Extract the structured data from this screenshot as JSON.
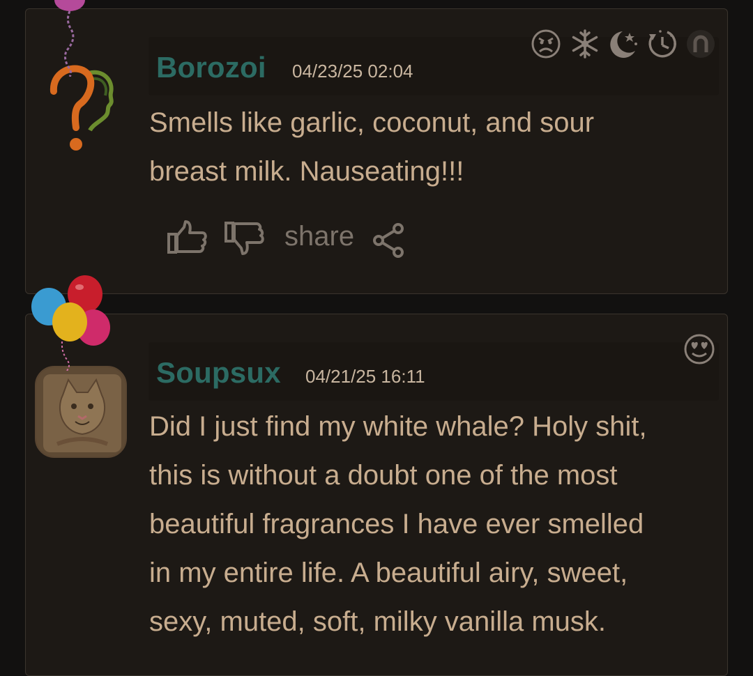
{
  "comments": [
    {
      "username": "Borozoi",
      "date": "04/23/25 02:04",
      "text": "Smells like garlic, coconut, and sour\nbreast milk. Nauseating!!!",
      "actions": {
        "share_label": "share"
      },
      "mood_icons": [
        "sad-face-icon",
        "snowflake-icon",
        "moon-stars-icon",
        "clock-icon",
        "arch-icon"
      ],
      "avatar": "question-head-icon"
    },
    {
      "username": "Soupsux",
      "date": "04/21/25 16:11",
      "text": "Did I just find my white whale? Holy shit,\nthis is without a doubt one of the most\nbeautiful fragrances I have ever smelled\nin my entire life. A beautiful airy, sweet,\nsexy, muted, soft, milky vanilla musk.",
      "mood_icons": [
        "heart-eyes-face-icon"
      ],
      "avatar": "cat-avatar"
    }
  ],
  "colors": {
    "username": "#2c6b63",
    "body_text": "#c8ad8f",
    "icon": "#8a8078",
    "card": "#1d1915"
  }
}
